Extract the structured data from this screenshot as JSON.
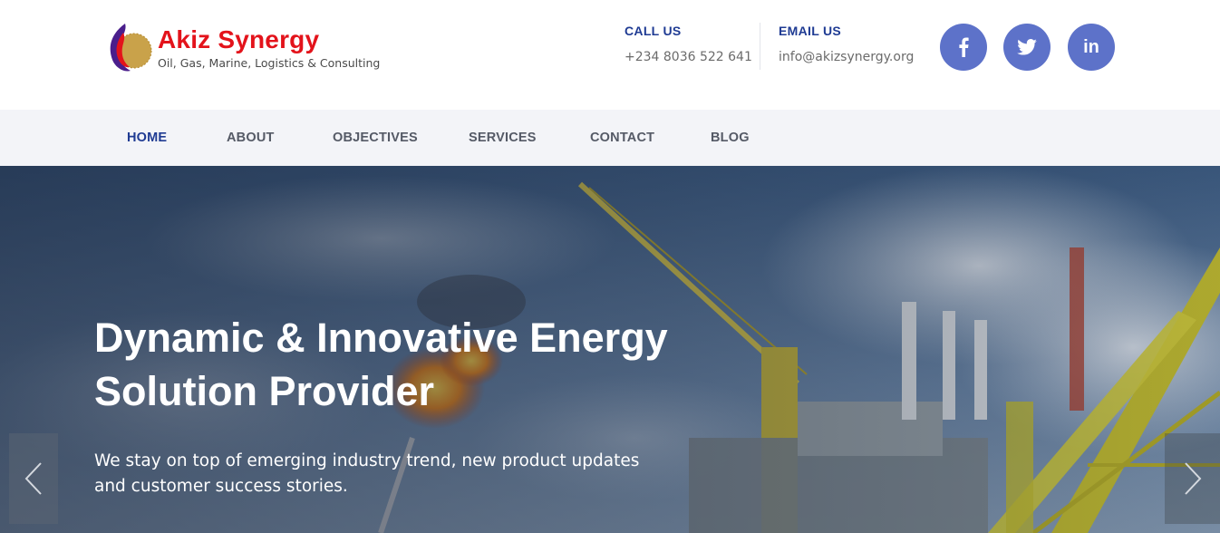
{
  "brand": {
    "name": "Akiz Synergy",
    "tagline": "Oil, Gas, Marine, Logistics & Consulting",
    "logo_icon": "flame-globe-logo"
  },
  "contact": {
    "call_label": "CALL US",
    "call_value": "+234 8036 522 641",
    "email_label": "EMAIL US",
    "email_value": "info@akizsynergy.org"
  },
  "social": {
    "facebook_icon": "facebook-icon",
    "twitter_icon": "twitter-icon",
    "linkedin_icon": "linkedin-icon",
    "linkedin_text": "in"
  },
  "nav": {
    "items": [
      {
        "label": "HOME",
        "active": true
      },
      {
        "label": "ABOUT",
        "active": false
      },
      {
        "label": "OBJECTIVES",
        "active": false
      },
      {
        "label": "SERVICES",
        "active": false
      },
      {
        "label": "CONTACT",
        "active": false
      },
      {
        "label": "BLOG",
        "active": false
      }
    ]
  },
  "hero": {
    "title_line1": "Dynamic & Innovative Energy",
    "title_line2": "Solution Provider",
    "subtitle": "We stay on top of emerging industry trend, new product updates and customer success stories.",
    "prev_icon": "chevron-left-icon",
    "next_icon": "chevron-right-icon"
  },
  "colors": {
    "brand_red": "#e3131b",
    "accent_blue": "#1f3b93",
    "social_bg": "#5d72c9",
    "nav_bg": "#f3f4f8",
    "nav_text": "#555a66"
  }
}
